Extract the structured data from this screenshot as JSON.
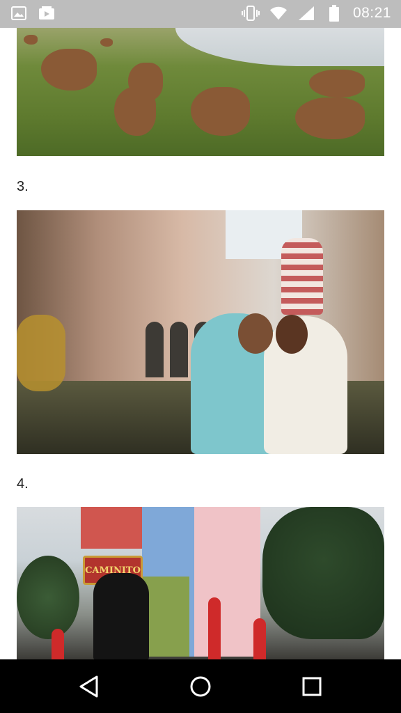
{
  "status_bar": {
    "left_icons": [
      "image-icon",
      "video-icon"
    ],
    "right_icons": [
      "vibrate-icon",
      "wifi-icon",
      "signal-icon",
      "battery-icon"
    ],
    "time": "08:21",
    "bg_color": "#bdbdbd"
  },
  "article": {
    "items": [
      {
        "number": "",
        "image": "kangaroos-photo"
      },
      {
        "number": "3.",
        "image": "venice-gondola-photo"
      },
      {
        "number": "4.",
        "image": "caminito-tango-photo",
        "sign_text": "CAMINITO"
      }
    ]
  },
  "nav_bar": {
    "buttons": [
      "back-icon",
      "home-icon",
      "recents-icon"
    ],
    "bg_color": "#000000"
  }
}
